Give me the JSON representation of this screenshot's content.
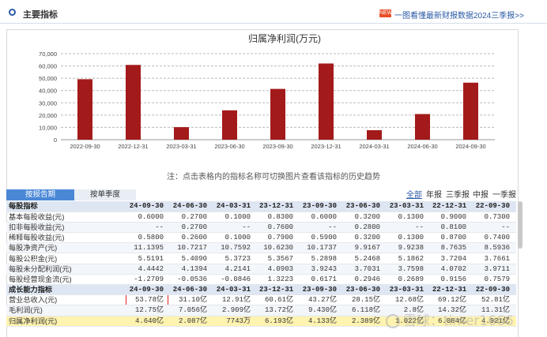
{
  "header": {
    "title": "主要指标",
    "badge": "NEW",
    "link": "一图看懂最新财报数据2024三季报>>"
  },
  "chart_data": {
    "type": "bar",
    "title": "归属净利润(万元)",
    "categories": [
      "2022-09-30",
      "2022-12-31",
      "2023-03-31",
      "2023-06-30",
      "2023-09-30",
      "2023-12-31",
      "2024-03-31",
      "2024-06-30",
      "2024-09-30"
    ],
    "values": [
      49210,
      60840,
      10200,
      23900,
      41330,
      62000,
      7743,
      20870,
      46400
    ],
    "yticks": [
      "70,000",
      "60,000",
      "50,000",
      "40,000",
      "30,000",
      "20,000",
      "10,000",
      "0"
    ],
    "ylim": [
      0,
      70000
    ],
    "bar_color": "#a31a1a",
    "grid": "dashed horizontal"
  },
  "note": "注：点击表格内的指标名称可切换图片查看该指标的历史趋势",
  "tabs": {
    "report_period": "按报告期",
    "single_quarter": "按单季度"
  },
  "period_filters": [
    "全部",
    "年报",
    "三季报",
    "中报",
    "一季报"
  ],
  "table": {
    "periods": [
      "24-09-30",
      "24-06-30",
      "24-03-31",
      "23-12-31",
      "23-09-30",
      "23-06-30",
      "23-03-31",
      "22-12-31",
      "22-09-30"
    ],
    "sections": [
      {
        "name": "每股指标",
        "rows": [
          {
            "label": "基本每股收益(元)",
            "values": [
              "0.6000",
              "0.2700",
              "0.1000",
              "0.8300",
              "0.6000",
              "0.3200",
              "0.1300",
              "0.9000",
              "0.7300"
            ]
          },
          {
            "label": "扣非每股收益(元)",
            "values": [
              "--",
              "0.2700",
              "--",
              "0.7600",
              "--",
              "0.2800",
              "--",
              "0.8100",
              "--"
            ]
          },
          {
            "label": "稀释每股收益(元)",
            "values": [
              "0.5800",
              "0.2600",
              "0.1000",
              "0.7900",
              "0.5900",
              "0.3200",
              "0.1300",
              "0.8700",
              "0.7400"
            ]
          },
          {
            "label": "每股净资产(元)",
            "values": [
              "11.1395",
              "10.7217",
              "10.7592",
              "10.6230",
              "10.1737",
              "9.9167",
              "9.9238",
              "8.7635",
              "8.5936"
            ]
          },
          {
            "label": "每股公积金(元)",
            "values": [
              "5.5191",
              "5.4090",
              "5.3723",
              "5.3567",
              "5.2898",
              "5.2468",
              "5.1862",
              "3.7204",
              "3.7661"
            ]
          },
          {
            "label": "每股未分配利润(元)",
            "values": [
              "4.4442",
              "4.1394",
              "4.2141",
              "4.0903",
              "3.9243",
              "3.7031",
              "3.7598",
              "4.0702",
              "3.9711"
            ]
          },
          {
            "label": "每股经营现金流(元)",
            "values": [
              "-1.2709",
              "-0.0536",
              "-0.0846",
              "1.3223",
              "0.6171",
              "0.2946",
              "0.2689",
              "0.9156",
              "0.7579"
            ]
          }
        ]
      },
      {
        "name": "成长能力指标",
        "rows": [
          {
            "label": "营业总收入(元)",
            "values": [
              "53.78亿",
              "31.10亿",
              "12.91亿",
              "60.61亿",
              "43.27亿",
              "28.15亿",
              "12.68亿",
              "69.12亿",
              "52.81亿"
            ]
          },
          {
            "label": "毛利润(元)",
            "values": [
              "12.75亿",
              "7.056亿",
              "2.909亿",
              "13.72亿",
              "9.430亿",
              "6.118亿",
              "2.8亿",
              "14.32亿",
              "11.31亿"
            ]
          },
          {
            "label": "归属净利润(元)",
            "values": [
              "4.640亿",
              "2.087亿",
              "7743万",
              "6.193亿",
              "4.133亿",
              "2.389亿",
              "1.022亿",
              "6.084亿",
              "4.921亿"
            ]
          }
        ]
      }
    ]
  },
  "watermark": "雪球：timer1666"
}
